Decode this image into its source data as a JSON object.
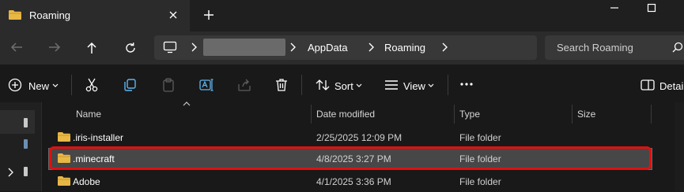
{
  "tab": {
    "title": "Roaming"
  },
  "address": {
    "crumbs": [
      "AppData",
      "Roaming"
    ]
  },
  "search": {
    "placeholder": "Search Roaming"
  },
  "toolbar": {
    "new_label": "New",
    "sort_label": "Sort",
    "view_label": "View",
    "details_label": "Details"
  },
  "columns": [
    "Name",
    "Date modified",
    "Type",
    "Size"
  ],
  "rows": [
    {
      "name": ".iris-installer",
      "date": "2/25/2025 12:09 PM",
      "type": "File folder"
    },
    {
      "name": ".minecraft",
      "date": "4/8/2025 3:27 PM",
      "type": "File folder",
      "selected": true
    },
    {
      "name": "Adobe",
      "date": "4/1/2025 3:36 PM",
      "type": "File folder"
    }
  ],
  "colors": {
    "folder": "#e8b846",
    "highlight": "#e01010",
    "background": "#191919"
  }
}
